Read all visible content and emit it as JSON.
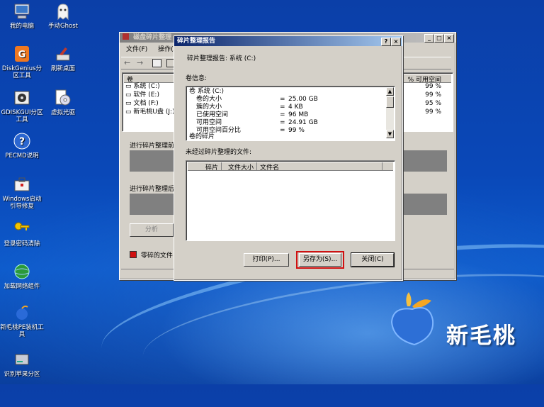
{
  "desktop_icons": [
    {
      "label": "我的电脑"
    },
    {
      "label": "手动Ghost"
    },
    {
      "label": "DiskGenius分区工具"
    },
    {
      "label": "刷新桌面"
    },
    {
      "label": "GDISKGUI分区工具"
    },
    {
      "label": "虚拟光驱"
    },
    {
      "label": "PECMD说明"
    },
    {
      "label": "Windows启动引导修复"
    },
    {
      "label": "登录密码清除"
    },
    {
      "label": "加载网络组件"
    },
    {
      "label": "新毛桃PE装机工具"
    },
    {
      "label": "识别苹果分区"
    }
  ],
  "brand": {
    "name": "新毛桃",
    "color": "#ffffff",
    "accent": "#f5a623"
  },
  "main_window": {
    "title": "磁盘碎片整理",
    "menu": [
      "文件(F)",
      "操作(A)"
    ],
    "col_volume": "卷",
    "col_free_pct": "% 可用空间",
    "volumes": [
      {
        "name": "系统 (C:)",
        "free_pct": "99 %"
      },
      {
        "name": "软件 (E:)",
        "free_pct": "99 %"
      },
      {
        "name": "文档 (F:)",
        "free_pct": "95 %"
      },
      {
        "name": "新毛桃U盘 (J:)",
        "free_pct": "99 %"
      }
    ],
    "before_label": "进行碎片整理前",
    "after_label": "进行碎片整理后",
    "analyze_button": "分析",
    "legend_fragmented": "零碎的文件"
  },
  "dialog": {
    "title": "碎片整理报告",
    "help_btn": "?",
    "close_btn": "×",
    "report_line": "碎片整理报告: 系统 (C:)",
    "volume_info_label": "卷信息:",
    "info_rows": [
      {
        "label": "卷 系统 (C:)",
        "eq": "",
        "value": ""
      },
      {
        "label": "卷的大小",
        "eq": "=",
        "value": "25.00 GB"
      },
      {
        "label": "簇的大小",
        "eq": "=",
        "value": "4 KB"
      },
      {
        "label": "已使用空间",
        "eq": "=",
        "value": "96 MB"
      },
      {
        "label": "可用空间",
        "eq": "=",
        "value": "24.91 GB"
      },
      {
        "label": "可用空间百分比",
        "eq": "=",
        "value": "99 %"
      },
      {
        "label": "卷的碎片",
        "eq": "",
        "value": ""
      }
    ],
    "unfrag_label": "未经过碎片整理的文件:",
    "col_frag": "碎片",
    "col_size": "文件大小",
    "col_name": "文件名",
    "print_button": "打印(P)...",
    "saveas_button": "另存为(S)...",
    "close_button": "关闭(C)",
    "highlight_color": "#d01010"
  }
}
